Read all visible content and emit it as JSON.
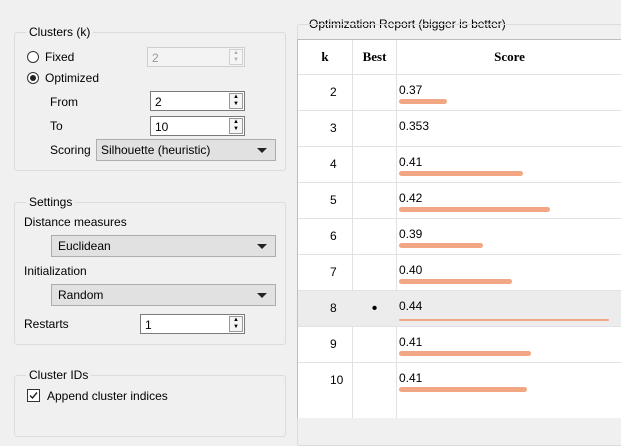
{
  "clusters": {
    "title": "Clusters (k)",
    "fixed_label": "Fixed",
    "fixed_value": "2",
    "optimized_label": "Optimized",
    "selected_mode": "Optimized",
    "from_label": "From",
    "from_value": "2",
    "to_label": "To",
    "to_value": "10",
    "scoring_label": "Scoring",
    "scoring_value": "Silhouette (heuristic)"
  },
  "settings": {
    "title": "Settings",
    "distance_label": "Distance measures",
    "distance_value": "Euclidean",
    "init_label": "Initialization",
    "init_value": "Random",
    "restarts_label": "Restarts",
    "restarts_value": "1"
  },
  "cluster_ids": {
    "title": "Cluster IDs",
    "append_label": "Append cluster indices",
    "append_checked": true
  },
  "report": {
    "title": "Optimization Report (bigger is better)",
    "headers": {
      "k": "k",
      "best": "Best",
      "score": "Score"
    },
    "rows": [
      {
        "k": "2",
        "best": "",
        "score": "0.37",
        "bar": 0.23
      },
      {
        "k": "3",
        "best": "",
        "score": "0.353",
        "bar": 0
      },
      {
        "k": "4",
        "best": "",
        "score": "0.41",
        "bar": 0.59
      },
      {
        "k": "5",
        "best": "",
        "score": "0.42",
        "bar": 0.72
      },
      {
        "k": "6",
        "best": "",
        "score": "0.39",
        "bar": 0.4
      },
      {
        "k": "7",
        "best": "",
        "score": "0.40",
        "bar": 0.54
      },
      {
        "k": "8",
        "best": "•",
        "score": "0.44",
        "bar": 1.0
      },
      {
        "k": "9",
        "best": "",
        "score": "0.41",
        "bar": 0.63
      },
      {
        "k": "10",
        "best": "",
        "score": "0.41",
        "bar": 0.61
      }
    ],
    "bar_color": "#f2a683",
    "selected_row_k": "8"
  }
}
